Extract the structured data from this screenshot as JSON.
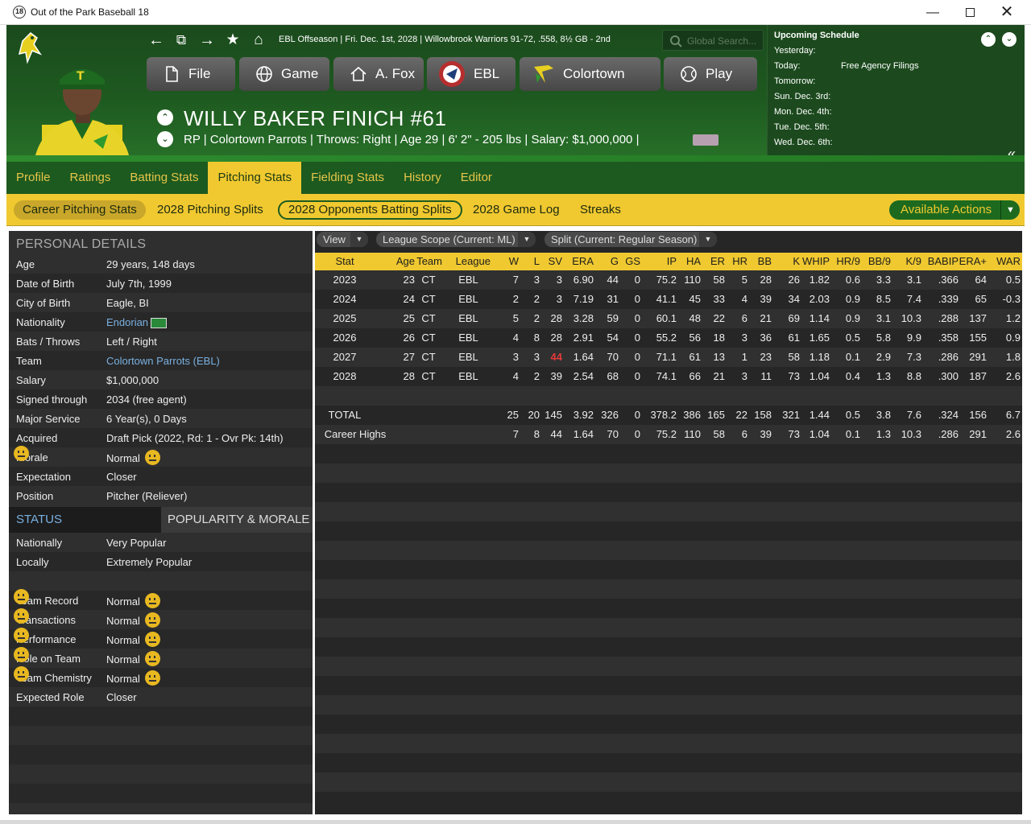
{
  "window": {
    "title": "Out of the Park Baseball 18",
    "icon_text": "18"
  },
  "header": {
    "info_line": "EBL Offseason  |  Fri. Dec. 1st, 2028  |  Willowbrook Warriors  91-72, .558, 8½ GB - 2nd",
    "search_placeholder": "Global Search...",
    "menu": [
      {
        "label": "File",
        "icon": "file-icon"
      },
      {
        "label": "Game",
        "icon": "globe-icon"
      },
      {
        "label": "A. Fox",
        "icon": "home-icon"
      },
      {
        "label": "EBL",
        "icon": "ebl-logo-icon"
      },
      {
        "label": "Colortown",
        "icon": "parrot-logo-icon"
      },
      {
        "label": "Play",
        "icon": "baseball-icon"
      }
    ],
    "player_name": "WILLY BAKER FINICH  #61",
    "player_sub": "RP | Colortown Parrots  |  Throws: Right  |  Age 29  |  6' 2\" - 205 lbs  |  Salary: $1,000,000  |"
  },
  "schedule": {
    "title": "Upcoming Schedule",
    "rows": [
      {
        "label": "Yesterday:",
        "value": ""
      },
      {
        "label": "Today:",
        "value": "Free Agency Filings"
      },
      {
        "label": "Tomorrow:",
        "value": ""
      },
      {
        "label": "Sun. Dec. 3rd:",
        "value": ""
      },
      {
        "label": "Mon. Dec. 4th:",
        "value": ""
      },
      {
        "label": "Tue. Dec. 5th:",
        "value": ""
      },
      {
        "label": "Wed. Dec. 6th:",
        "value": ""
      }
    ]
  },
  "tabs": [
    "Profile",
    "Ratings",
    "Batting Stats",
    "Pitching Stats",
    "Fielding Stats",
    "History",
    "Editor"
  ],
  "active_tab": "Pitching Stats",
  "subtabs": [
    "Career Pitching Stats",
    "2028 Pitching Splits",
    "2028 Opponents Batting Splits",
    "2028 Game Log",
    "Streaks"
  ],
  "available_actions": "Available Actions",
  "personal": {
    "title": "PERSONAL DETAILS",
    "rows": [
      {
        "k": "Age",
        "v": "29 years, 148 days"
      },
      {
        "k": "Date of Birth",
        "v": "July 7th, 1999"
      },
      {
        "k": "City of Birth",
        "v": "Eagle, BI"
      },
      {
        "k": "Nationality",
        "v": "Endorian"
      },
      {
        "k": "Bats / Throws",
        "v": "Left / Right"
      },
      {
        "k": "Team",
        "v": "Colortown Parrots (EBL)"
      },
      {
        "k": "Salary",
        "v": "$1,000,000"
      },
      {
        "k": "Signed through",
        "v": "2034 (free agent)"
      },
      {
        "k": "Major Service",
        "v": "6 Year(s), 0 Days"
      },
      {
        "k": "Acquired",
        "v": "Draft Pick (2022, Rd: 1 - Ovr Pk: 14th)"
      },
      {
        "k": "Morale",
        "v": "Normal"
      },
      {
        "k": "Expectation",
        "v": "Closer"
      },
      {
        "k": "Position",
        "v": "Pitcher (Reliever)"
      }
    ]
  },
  "status": {
    "tab_status": "STATUS",
    "tab_popularity": "POPULARITY & MORALE",
    "rows": [
      {
        "k": "Nationally",
        "v": "Very Popular"
      },
      {
        "k": "Locally",
        "v": "Extremely Popular"
      },
      {
        "k": "",
        "v": ""
      },
      {
        "k": "Team Record",
        "v": "Normal"
      },
      {
        "k": "Transactions",
        "v": "Normal"
      },
      {
        "k": "Performance",
        "v": "Normal"
      },
      {
        "k": "Role on Team",
        "v": "Normal"
      },
      {
        "k": "Team Chemistry",
        "v": "Normal"
      },
      {
        "k": "Expected Role",
        "v": "Closer"
      }
    ]
  },
  "filters": {
    "view": "View",
    "scope": "League Scope  (Current: ML)",
    "split": "Split  (Current: Regular Season)"
  },
  "stats": {
    "columns": [
      "Stat",
      "Age",
      "Team",
      "League",
      "W",
      "L",
      "SV",
      "ERA",
      "G",
      "GS",
      "IP",
      "HA",
      "ER",
      "HR",
      "BB",
      "K",
      "WHIP",
      "HR/9",
      "BB/9",
      "K/9",
      "BABIP",
      "ERA+",
      "WAR"
    ],
    "rows": [
      [
        "2023",
        "23",
        "CT",
        "EBL",
        "7",
        "3",
        "3",
        "6.90",
        "44",
        "0",
        "75.2",
        "110",
        "58",
        "5",
        "28",
        "26",
        "1.82",
        "0.6",
        "3.3",
        "3.1",
        ".366",
        "64",
        "0.5"
      ],
      [
        "2024",
        "24",
        "CT",
        "EBL",
        "2",
        "2",
        "3",
        "7.19",
        "31",
        "0",
        "41.1",
        "45",
        "33",
        "4",
        "39",
        "34",
        "2.03",
        "0.9",
        "8.5",
        "7.4",
        ".339",
        "65",
        "-0.3"
      ],
      [
        "2025",
        "25",
        "CT",
        "EBL",
        "5",
        "2",
        "28",
        "3.28",
        "59",
        "0",
        "60.1",
        "48",
        "22",
        "6",
        "21",
        "69",
        "1.14",
        "0.9",
        "3.1",
        "10.3",
        ".288",
        "137",
        "1.2"
      ],
      [
        "2026",
        "26",
        "CT",
        "EBL",
        "4",
        "8",
        "28",
        "2.91",
        "54",
        "0",
        "55.2",
        "56",
        "18",
        "3",
        "36",
        "61",
        "1.65",
        "0.5",
        "5.8",
        "9.9",
        ".358",
        "155",
        "0.9"
      ],
      [
        "2027",
        "27",
        "CT",
        "EBL",
        "3",
        "3",
        "44",
        "1.64",
        "70",
        "0",
        "71.1",
        "61",
        "13",
        "1",
        "23",
        "58",
        "1.18",
        "0.1",
        "2.9",
        "7.3",
        ".286",
        "291",
        "1.8"
      ],
      [
        "2028",
        "28",
        "CT",
        "EBL",
        "4",
        "2",
        "39",
        "2.54",
        "68",
        "0",
        "74.1",
        "66",
        "21",
        "3",
        "11",
        "73",
        "1.04",
        "0.4",
        "1.3",
        "8.8",
        ".300",
        "187",
        "2.6"
      ],
      [
        "",
        "",
        "",
        "",
        "",
        "",
        "",
        "",
        "",
        "",
        "",
        "",
        "",
        "",
        "",
        "",
        "",
        "",
        "",
        "",
        "",
        "",
        ""
      ],
      [
        "TOTAL",
        "",
        "",
        "",
        "25",
        "20",
        "145",
        "3.92",
        "326",
        "0",
        "378.2",
        "386",
        "165",
        "22",
        "158",
        "321",
        "1.44",
        "0.5",
        "3.8",
        "7.6",
        ".324",
        "156",
        "6.7"
      ],
      [
        "Career Highs",
        "",
        "",
        "",
        "7",
        "8",
        "44",
        "1.64",
        "70",
        "0",
        "75.2",
        "110",
        "58",
        "6",
        "39",
        "73",
        "1.04",
        "0.1",
        "1.3",
        "10.3",
        ".286",
        "291",
        "2.6"
      ]
    ],
    "highlight": {
      "row": 4,
      "col": 6,
      "color": "#e23b3b"
    }
  }
}
